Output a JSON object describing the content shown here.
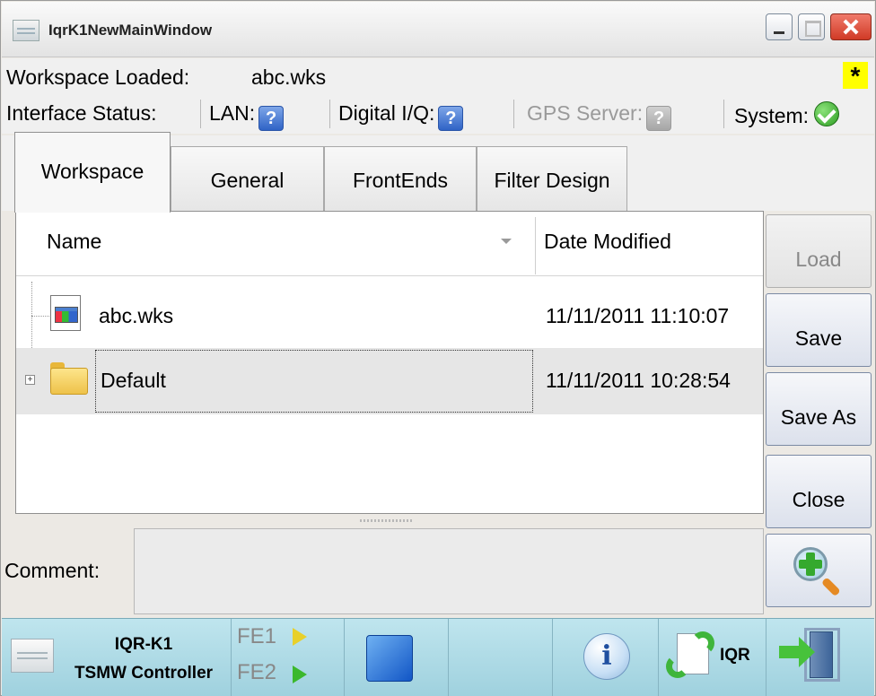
{
  "window": {
    "title": "IqrK1NewMainWindow",
    "controls": {
      "minimize": "minimize-icon",
      "maximize": "maximize-icon",
      "close": "close-icon"
    }
  },
  "workspace": {
    "label": "Workspace Loaded:",
    "value": "abc.wks",
    "modified_marker": "*"
  },
  "interface_status": {
    "label": "Interface Status:",
    "lan": {
      "label": "LAN:",
      "status": "?"
    },
    "digital_iq": {
      "label": "Digital I/Q:",
      "status": "?"
    },
    "gps_server": {
      "label": "GPS Server:",
      "status": "?"
    },
    "system": {
      "label": "System:",
      "status_icon": "checkmark-ok-icon"
    }
  },
  "tabs": [
    {
      "label": "Workspace",
      "active": true
    },
    {
      "label": "General",
      "active": false
    },
    {
      "label": "FrontEnds",
      "active": false
    },
    {
      "label": "Filter Design",
      "active": false
    }
  ],
  "file_list": {
    "columns": [
      "Name",
      "Date Modified"
    ],
    "rows": [
      {
        "name": "abc.wks",
        "date": "11/11/2011 11:10:07",
        "icon": "workspace-file-icon"
      },
      {
        "name": "Default",
        "date": "11/11/2011 10:28:54",
        "icon": "folder-icon",
        "selected": true
      }
    ]
  },
  "side_buttons": {
    "load": "Load",
    "save": "Save",
    "save_as": "Save As",
    "close": "Close",
    "zoom": "zoom-in-icon"
  },
  "comment": {
    "label": "Comment:",
    "value": ""
  },
  "bottom_bar": {
    "controller_line1": "IQR-K1",
    "controller_line2": "TSMW Controller",
    "fe1": "FE1",
    "fe2": "FE2",
    "iqr_label": "IQR",
    "colors": {
      "fe1_arrow": "#e8d02a",
      "fe2_arrow": "#3bb82c",
      "bar": "#a9d8e4"
    }
  }
}
